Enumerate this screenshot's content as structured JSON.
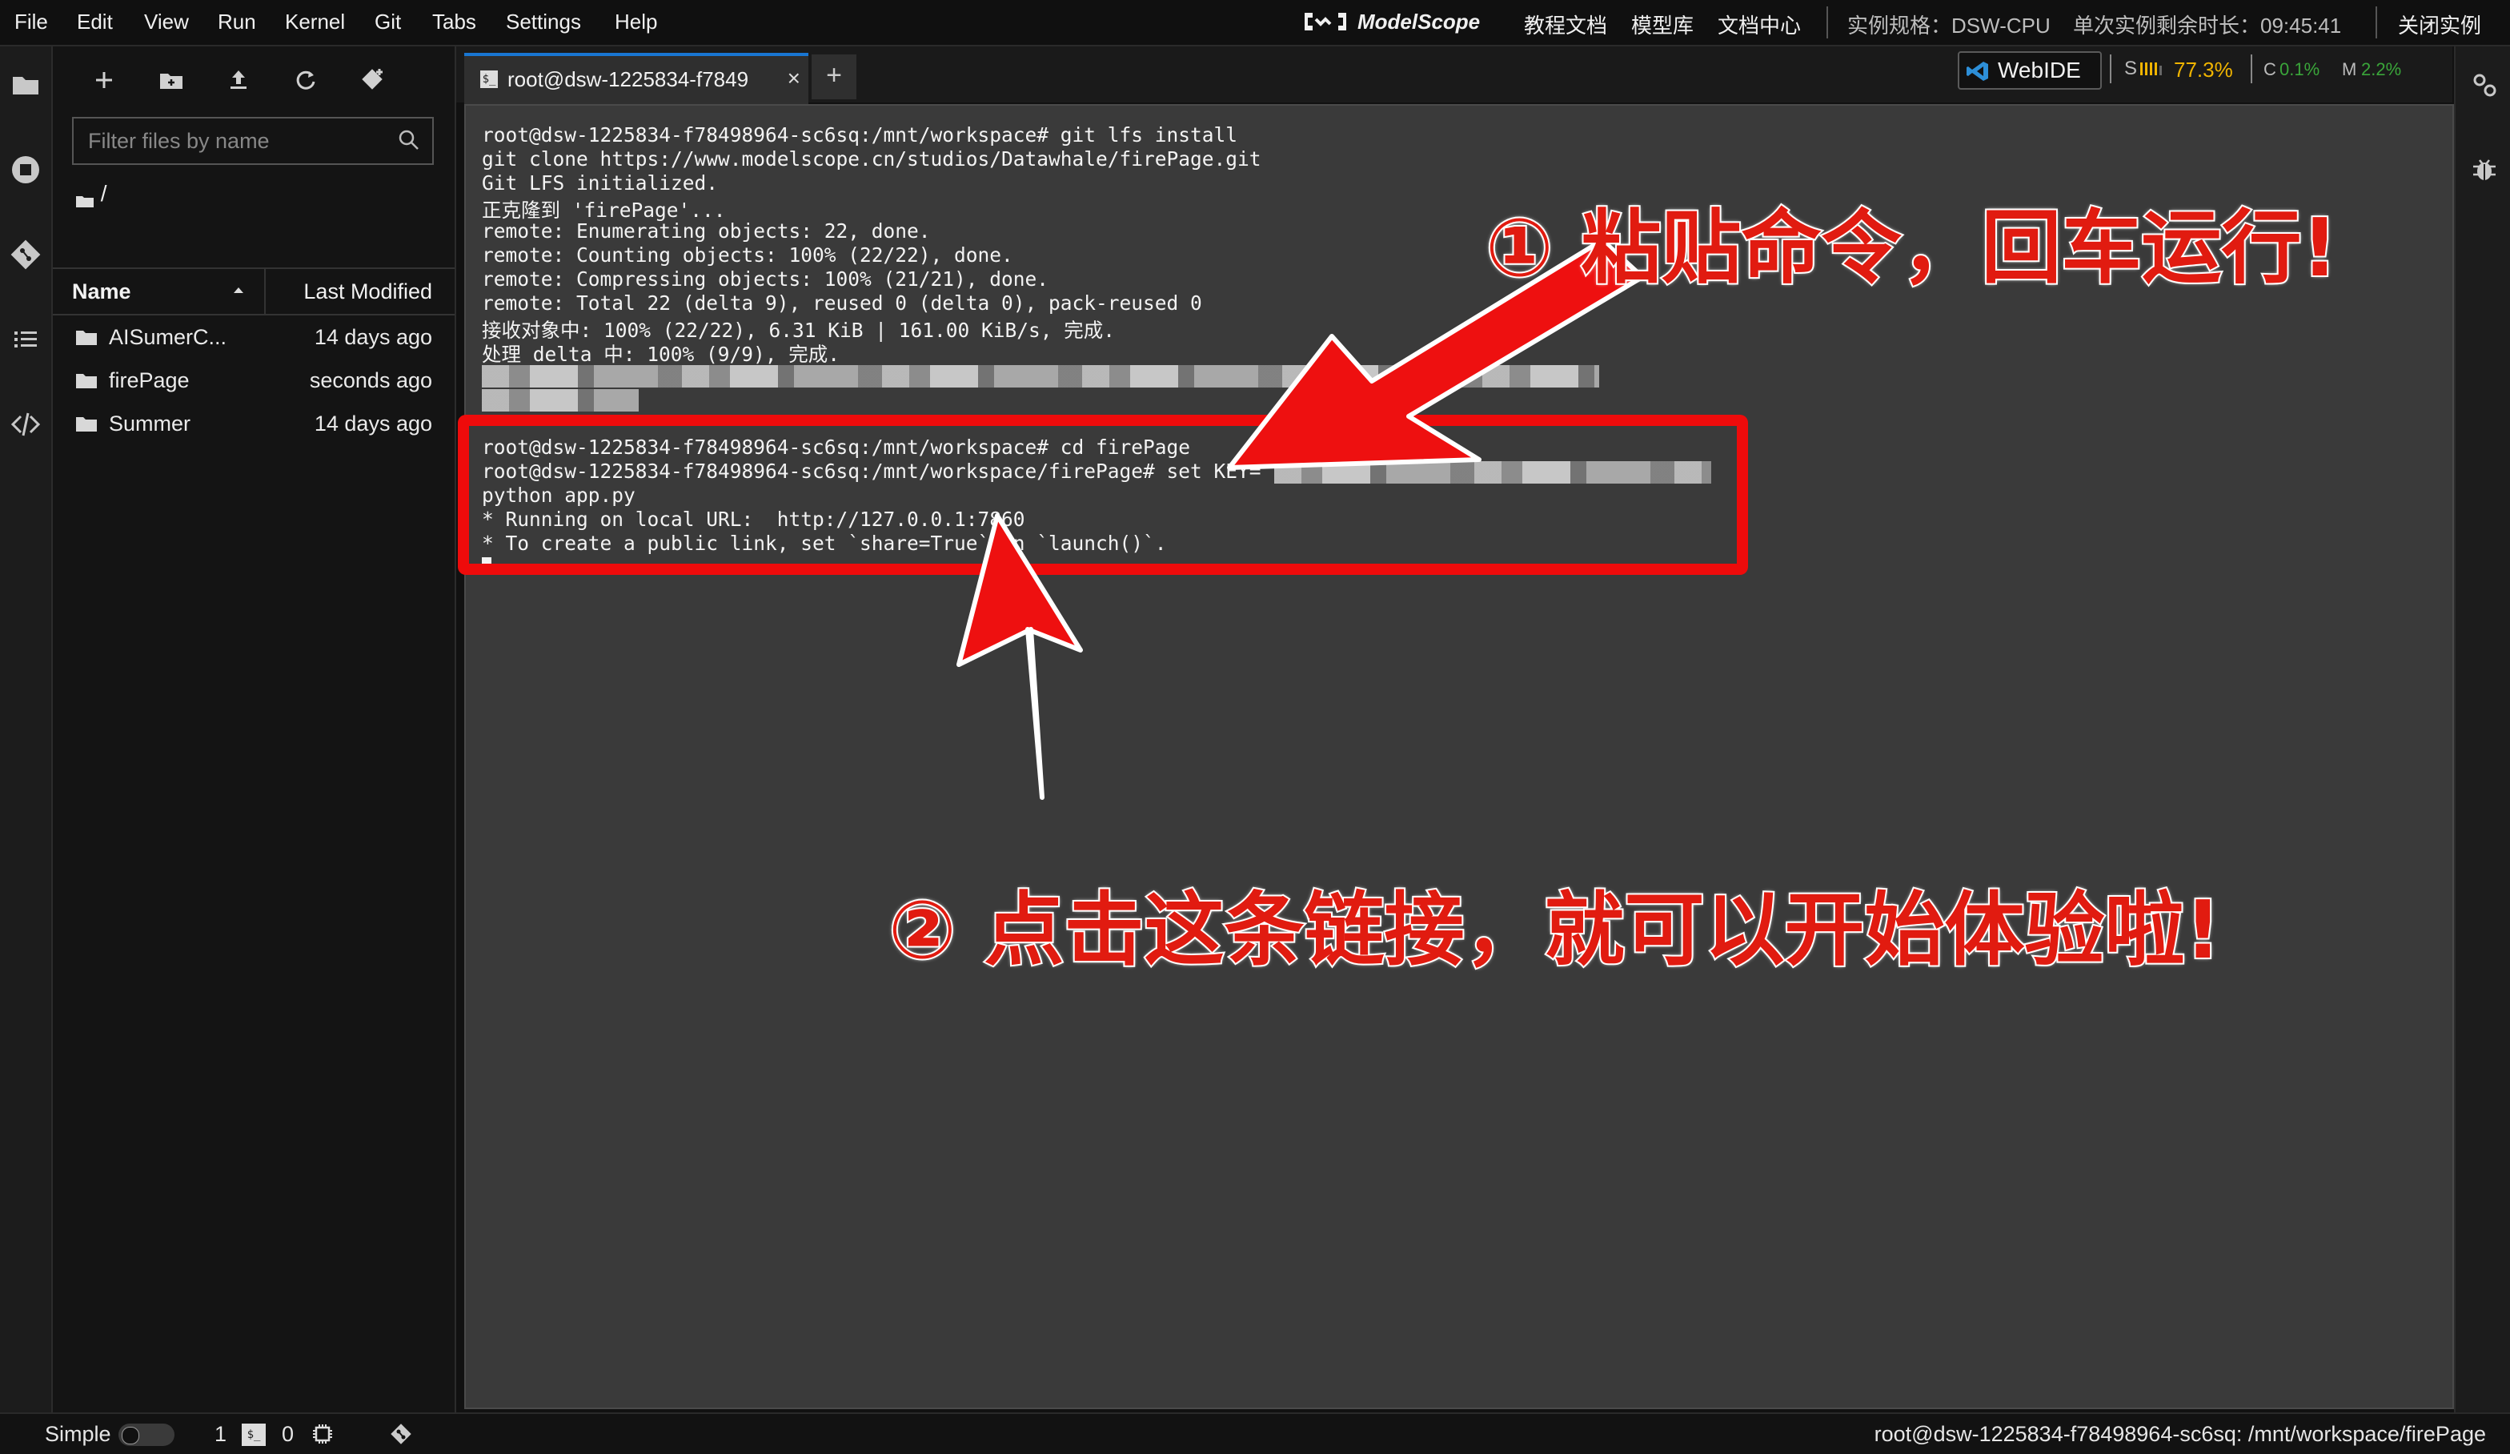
{
  "menubar": {
    "items": [
      "File",
      "Edit",
      "View",
      "Run",
      "Kernel",
      "Git",
      "Tabs",
      "Settings",
      "Help"
    ],
    "brand": "ModelScope",
    "links": [
      "教程文档",
      "模型库",
      "文档中心"
    ],
    "instance_spec": "实例规格：DSW-CPU",
    "remaining_time": "单次实例剩余时长：09:45:41",
    "close_instance": "关闭实例"
  },
  "filebrowser": {
    "filter_placeholder": "Filter files by name",
    "breadcrumb": "/",
    "columns": {
      "name": "Name",
      "modified": "Last Modified"
    },
    "files": [
      {
        "name": "AISumerC...",
        "modified": "14 days ago"
      },
      {
        "name": "firePage",
        "modified": "seconds ago"
      },
      {
        "name": "Summer",
        "modified": "14 days ago"
      }
    ]
  },
  "tabs": {
    "active_tab": "root@dsw-1225834-f7849",
    "new_tab": "+"
  },
  "resource_widget": {
    "webide_label": "WebIDE",
    "storage_label": "S",
    "storage_value": "77.3%",
    "cpu_label": "C",
    "cpu_value": "0.1%",
    "mem_label": "M",
    "mem_value": "2.2%",
    "colors": {
      "storage": "#f0b400",
      "cpu": "#3aa63a",
      "mem": "#3aa63a"
    }
  },
  "terminal": {
    "lines_top": [
      "root@dsw-1225834-f78498964-sc6sq:/mnt/workspace# git lfs install",
      "git clone https://www.modelscope.cn/studios/Datawhale/firePage.git",
      "Git LFS initialized.",
      "正克隆到 'firePage'...",
      "remote: Enumerating objects: 22, done.",
      "remote: Counting objects: 100% (22/22), done.",
      "remote: Compressing objects: 100% (21/21), done.",
      "remote: Total 22 (delta 9), reused 0 (delta 0), pack-reused 0",
      "接收对象中: 100% (22/22), 6.31 KiB | 161.00 KiB/s, 完成.",
      "处理 delta 中: 100% (9/9), 完成."
    ],
    "lines_bottom": [
      "root@dsw-1225834-f78498964-sc6sq:/mnt/workspace# cd firePage",
      "root@dsw-1225834-f78498964-sc6sq:/mnt/workspace/firePage# set KEY=",
      "python app.py",
      "* Running on local URL:  http://127.0.0.1:7860",
      "* To create a public link, set `share=True` in `launch()`."
    ]
  },
  "annotations": {
    "step1": "① 粘贴命令，回车运行!",
    "step2": "② 点击这条链接，就可以开始体验啦!",
    "color": "#e11b10"
  },
  "statusbar": {
    "mode": "Simple",
    "terminals_count": "1",
    "kernels_count": "0",
    "cwd": "root@dsw-1225834-f78498964-sc6sq: /mnt/workspace/firePage"
  }
}
